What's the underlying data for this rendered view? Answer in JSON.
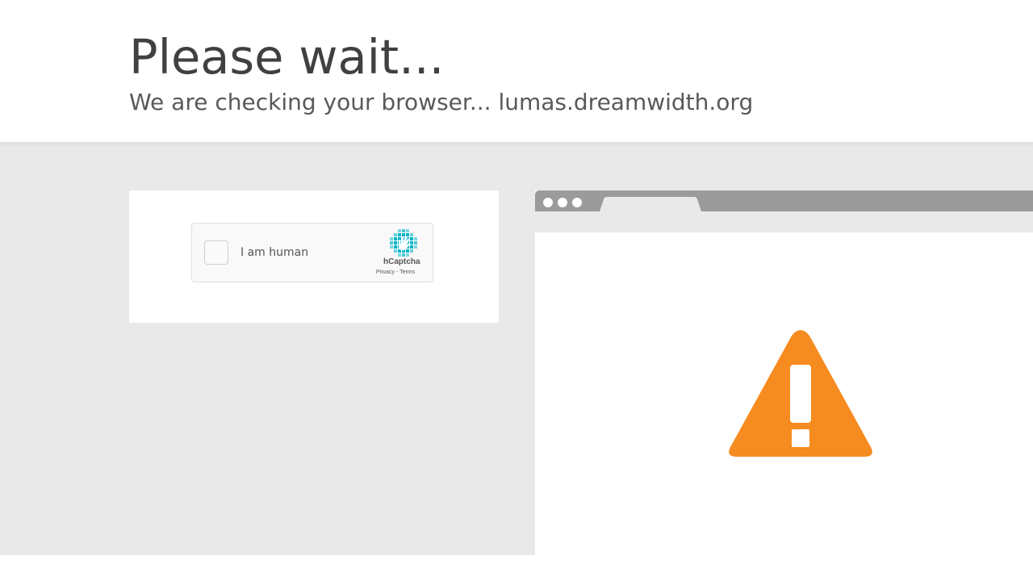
{
  "header": {
    "title": "Please wait...",
    "subtitle": "We are checking your browser... lumas.dreamwidth.org"
  },
  "captcha": {
    "checkbox_label": "I am human",
    "brand": "hCaptcha",
    "privacy_link": "Privacy",
    "separator": " - ",
    "terms_link": "Terms",
    "logo_icon": "hcaptcha-hand-icon",
    "logo_color": "#00b5c9"
  },
  "browser_illustration": {
    "icon": "warning-icon",
    "icon_color": "#f68b1f"
  },
  "colors": {
    "band_background": "#e9e9e9",
    "title_text": "#404040"
  }
}
